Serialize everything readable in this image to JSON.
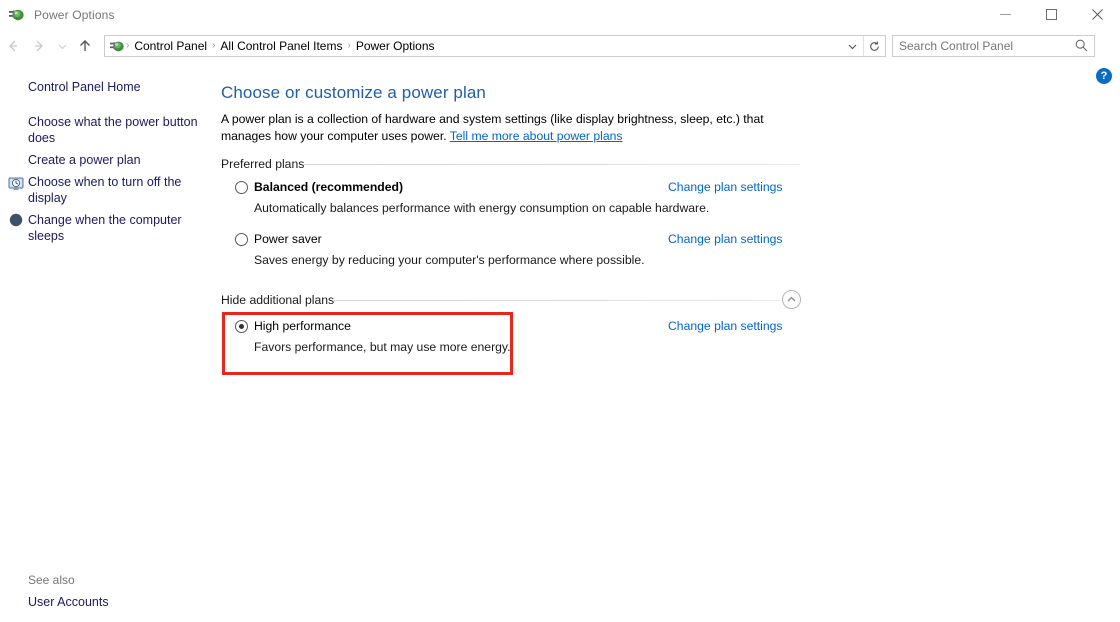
{
  "window": {
    "title": "Power Options",
    "title_icon": "power-plug-icon",
    "controls": {
      "minimize": "minimize-icon",
      "maximize": "maximize-icon",
      "close": "close-icon"
    }
  },
  "nav": {
    "back": "back-arrow-icon",
    "forward": "forward-arrow-icon",
    "recent": "recent-locations-chevron-icon",
    "up": "up-arrow-icon",
    "address_icon": "power-plug-icon",
    "breadcrumbs": [
      "Control Panel",
      "All Control Panel Items",
      "Power Options"
    ],
    "separator": "›",
    "dropdown": "chevron-down-icon",
    "refresh": "refresh-icon"
  },
  "search": {
    "placeholder": "Search Control Panel",
    "icon": "search-icon"
  },
  "sidebar": {
    "home": "Control Panel Home",
    "items": [
      {
        "label": "Choose what the power button does",
        "icon": null
      },
      {
        "label": "Create a power plan",
        "icon": null
      },
      {
        "label": "Choose when to turn off the display",
        "icon": "monitor-clock-icon"
      },
      {
        "label": "Change when the computer sleeps",
        "icon": "moon-icon"
      }
    ],
    "see_also_label": "See also",
    "see_also_link": "User Accounts"
  },
  "main": {
    "help": "?",
    "page_title": "Choose or customize a power plan",
    "description_part1": "A power plan is a collection of hardware and system settings (like display brightness, sleep, etc.) that manages how your computer uses power. ",
    "description_link": "Tell me more about power plans",
    "preferred_group": "Preferred plans",
    "additional_group": "Hide additional plans",
    "collapse_icon": "chevron-up-icon",
    "plans": [
      {
        "name": "Balanced (recommended)",
        "bold": true,
        "description": "Automatically balances performance with energy consumption on capable hardware.",
        "selected": false,
        "link": "Change plan settings"
      },
      {
        "name": "Power saver",
        "bold": false,
        "description": "Saves energy by reducing your computer's performance where possible.",
        "selected": false,
        "link": "Change plan settings"
      },
      {
        "name": "High performance",
        "bold": false,
        "description": "Favors performance, but may use more energy.",
        "selected": true,
        "link": "Change plan settings"
      }
    ]
  },
  "colors": {
    "accent_link": "#0066cc",
    "title_blue": "#1f5fa9",
    "highlight_red": "#e8271c",
    "sidebar_link": "#1a1a5e"
  }
}
